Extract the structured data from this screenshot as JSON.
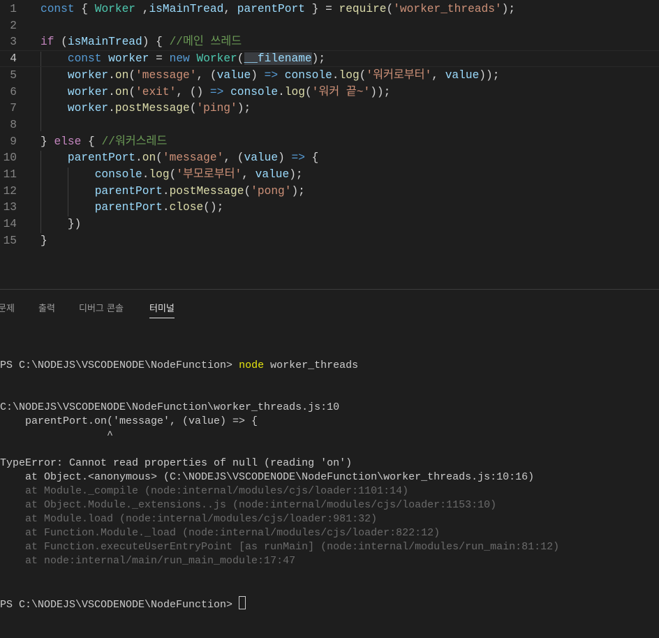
{
  "editor": {
    "active_line": 4,
    "lines": [
      [
        [
          "const",
          "kw"
        ],
        [
          " { ",
          "pl"
        ],
        [
          "Worker",
          "cls"
        ],
        [
          " ,",
          "pl"
        ],
        [
          "isMainTread",
          "var"
        ],
        [
          ", ",
          "pl"
        ],
        [
          "parentPort",
          "var"
        ],
        [
          " } = ",
          "pl"
        ],
        [
          "require",
          "fn"
        ],
        [
          "(",
          "pl"
        ],
        [
          "'worker_threads'",
          "str"
        ],
        [
          ");",
          "pl"
        ]
      ],
      [],
      [
        [
          "if",
          "ctl"
        ],
        [
          " (",
          "pl"
        ],
        [
          "isMainTread",
          "var"
        ],
        [
          ") { ",
          "pl"
        ],
        [
          "//메인 쓰레드",
          "cmt"
        ]
      ],
      [
        [
          "    ",
          "pl"
        ],
        [
          "const",
          "kw"
        ],
        [
          " ",
          "pl"
        ],
        [
          "worker",
          "var"
        ],
        [
          " = ",
          "pl"
        ],
        [
          "new",
          "kw"
        ],
        [
          " ",
          "pl"
        ],
        [
          "Worker",
          "cls"
        ],
        [
          "(",
          "pl"
        ],
        [
          "__filename",
          "hl"
        ],
        [
          ");",
          "pl"
        ]
      ],
      [
        [
          "    ",
          "pl"
        ],
        [
          "worker",
          "var"
        ],
        [
          ".",
          "pl"
        ],
        [
          "on",
          "fn"
        ],
        [
          "(",
          "pl"
        ],
        [
          "'message'",
          "str"
        ],
        [
          ", (",
          "pl"
        ],
        [
          "value",
          "var"
        ],
        [
          ") ",
          "pl"
        ],
        [
          "=>",
          "kw"
        ],
        [
          " ",
          "pl"
        ],
        [
          "console",
          "var"
        ],
        [
          ".",
          "pl"
        ],
        [
          "log",
          "fn"
        ],
        [
          "(",
          "pl"
        ],
        [
          "'워커로부터'",
          "str"
        ],
        [
          ", ",
          "pl"
        ],
        [
          "value",
          "var"
        ],
        [
          "));",
          "pl"
        ]
      ],
      [
        [
          "    ",
          "pl"
        ],
        [
          "worker",
          "var"
        ],
        [
          ".",
          "pl"
        ],
        [
          "on",
          "fn"
        ],
        [
          "(",
          "pl"
        ],
        [
          "'exit'",
          "str"
        ],
        [
          ", () ",
          "pl"
        ],
        [
          "=>",
          "kw"
        ],
        [
          " ",
          "pl"
        ],
        [
          "console",
          "var"
        ],
        [
          ".",
          "pl"
        ],
        [
          "log",
          "fn"
        ],
        [
          "(",
          "pl"
        ],
        [
          "'워커 끝~'",
          "str"
        ],
        [
          "));",
          "pl"
        ]
      ],
      [
        [
          "    ",
          "pl"
        ],
        [
          "worker",
          "var"
        ],
        [
          ".",
          "pl"
        ],
        [
          "postMessage",
          "fn"
        ],
        [
          "(",
          "pl"
        ],
        [
          "'ping'",
          "str"
        ],
        [
          ");",
          "pl"
        ]
      ],
      [],
      [
        [
          "} ",
          "pl"
        ],
        [
          "else",
          "ctl"
        ],
        [
          " { ",
          "pl"
        ],
        [
          "//워커스레드",
          "cmt"
        ]
      ],
      [
        [
          "    ",
          "pl"
        ],
        [
          "parentPort",
          "var"
        ],
        [
          ".",
          "pl"
        ],
        [
          "on",
          "fn"
        ],
        [
          "(",
          "pl"
        ],
        [
          "'message'",
          "str"
        ],
        [
          ", (",
          "pl"
        ],
        [
          "value",
          "var"
        ],
        [
          ") ",
          "pl"
        ],
        [
          "=>",
          "kw"
        ],
        [
          " {",
          "pl"
        ]
      ],
      [
        [
          "        ",
          "pl"
        ],
        [
          "console",
          "var"
        ],
        [
          ".",
          "pl"
        ],
        [
          "log",
          "fn"
        ],
        [
          "(",
          "pl"
        ],
        [
          "'부모로부터'",
          "str"
        ],
        [
          ", ",
          "pl"
        ],
        [
          "value",
          "var"
        ],
        [
          ");",
          "pl"
        ]
      ],
      [
        [
          "        ",
          "pl"
        ],
        [
          "parentPort",
          "var"
        ],
        [
          ".",
          "pl"
        ],
        [
          "postMessage",
          "fn"
        ],
        [
          "(",
          "pl"
        ],
        [
          "'pong'",
          "str"
        ],
        [
          ");",
          "pl"
        ]
      ],
      [
        [
          "        ",
          "pl"
        ],
        [
          "parentPort",
          "var"
        ],
        [
          ".",
          "pl"
        ],
        [
          "close",
          "fn"
        ],
        [
          "();",
          "pl"
        ]
      ],
      [
        [
          "    ",
          "pl"
        ],
        [
          "})",
          "pl"
        ]
      ],
      [
        [
          "}",
          "pl"
        ]
      ]
    ]
  },
  "panel": {
    "tabs": [
      {
        "label": "문제",
        "active": false
      },
      {
        "label": "출력",
        "active": false
      },
      {
        "label": "디버그 콘솔",
        "active": false
      },
      {
        "label": "터미널",
        "active": true
      }
    ]
  },
  "terminal": {
    "prompt1": "PS C:\\NODEJS\\VSCODENODE\\NodeFunction> ",
    "command_name": "node",
    "command_args": " worker_threads",
    "output": [
      {
        "text": "C:\\NODEJS\\VSCODENODE\\NodeFunction\\worker_threads.js:10",
        "dim": false
      },
      {
        "text": "    parentPort.on('message', (value) => {",
        "dim": false
      },
      {
        "text": "                 ^",
        "dim": false
      },
      {
        "text": "",
        "dim": false
      },
      {
        "text": "TypeError: Cannot read properties of null (reading 'on')",
        "dim": false
      },
      {
        "text": "    at Object.<anonymous> (C:\\NODEJS\\VSCODENODE\\NodeFunction\\worker_threads.js:10:16)",
        "dim": false
      },
      {
        "text": "    at Module._compile (node:internal/modules/cjs/loader:1101:14)",
        "dim": true
      },
      {
        "text": "    at Object.Module._extensions..js (node:internal/modules/cjs/loader:1153:10)",
        "dim": true
      },
      {
        "text": "    at Module.load (node:internal/modules/cjs/loader:981:32)",
        "dim": true
      },
      {
        "text": "    at Function.Module._load (node:internal/modules/cjs/loader:822:12)",
        "dim": true
      },
      {
        "text": "    at Function.executeUserEntryPoint [as runMain] (node:internal/modules/run_main:81:12)",
        "dim": true
      },
      {
        "text": "    at node:internal/main/run_main_module:17:47",
        "dim": true
      }
    ],
    "prompt2": "PS C:\\NODEJS\\VSCODENODE\\NodeFunction> "
  }
}
